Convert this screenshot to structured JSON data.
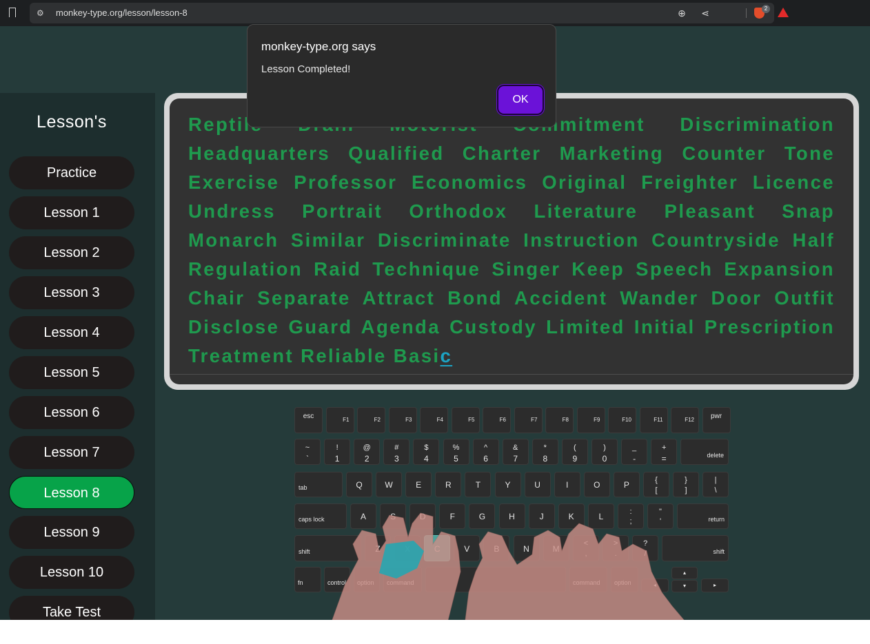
{
  "browser": {
    "url": "monkey-type.org/lesson/lesson-8",
    "shield_badge": "2"
  },
  "sidebar": {
    "title": "Lesson's",
    "items": [
      "Practice",
      "Lesson 1",
      "Lesson 2",
      "Lesson 3",
      "Lesson 4",
      "Lesson 5",
      "Lesson 6",
      "Lesson 7",
      "Lesson 8",
      "Lesson 9",
      "Lesson 10",
      "Take Test"
    ],
    "active": "Lesson 8"
  },
  "lesson": {
    "text": "Reptile Drain Motorist Commitment Discrimination Headquarters Qualified Charter Marketing Counter Tone Exercise Professor Economics Original Freighter Licence Undress Portrait Orthodox Literature Pleasant Snap Monarch Similar Discriminate Instruction Countryside Half Regulation Raid Technique Singer Keep Speech Expansion Chair Separate Attract Bond Accident Wander Door Outfit Disclose Guard Agenda Custody Limited Initial Prescription Treatment Reliable Basi",
    "current_char": "c"
  },
  "dialog": {
    "title": "monkey-type.org says",
    "message": "Lesson Completed!",
    "ok": "OK"
  },
  "keyboard": {
    "highlight": "C",
    "row_fn": [
      "esc",
      "F1",
      "F2",
      "F3",
      "F4",
      "F5",
      "F6",
      "F7",
      "F8",
      "F9",
      "F10",
      "F11",
      "F12",
      "pwr"
    ],
    "row_num": [
      [
        "~",
        "`"
      ],
      [
        "!",
        "1"
      ],
      [
        "@",
        "2"
      ],
      [
        "#",
        "3"
      ],
      [
        "$",
        "4"
      ],
      [
        "%",
        "5"
      ],
      [
        "^",
        "6"
      ],
      [
        "&",
        "7"
      ],
      [
        "*",
        "8"
      ],
      [
        "(",
        "9"
      ],
      [
        ")",
        "0"
      ],
      [
        "_",
        "-"
      ],
      [
        "+",
        "="
      ]
    ],
    "delete": "delete",
    "tab": "tab",
    "row_q": [
      "Q",
      "W",
      "E",
      "R",
      "T",
      "Y",
      "U",
      "I",
      "O",
      "P"
    ],
    "row_q_sym": [
      [
        "{",
        "["
      ],
      [
        "}",
        "]"
      ],
      [
        "|",
        "\\"
      ]
    ],
    "caps": "caps lock",
    "row_a": [
      "A",
      "S",
      "D",
      "F",
      "G",
      "H",
      "J",
      "K",
      "L"
    ],
    "row_a_sym": [
      [
        ":",
        ";"
      ],
      [
        "\"",
        "'"
      ]
    ],
    "return": "return",
    "shift": "shift",
    "row_z": [
      "Z",
      "X",
      "C",
      "V",
      "B",
      "N",
      "M"
    ],
    "row_z_sym": [
      [
        "<",
        ","
      ],
      [
        ">",
        "."
      ],
      [
        "?",
        "/"
      ]
    ],
    "bottom": [
      "fn",
      "control",
      "option",
      "command",
      "command",
      "option"
    ],
    "arrows": [
      "◂",
      "▴",
      "▾",
      "▸"
    ]
  }
}
